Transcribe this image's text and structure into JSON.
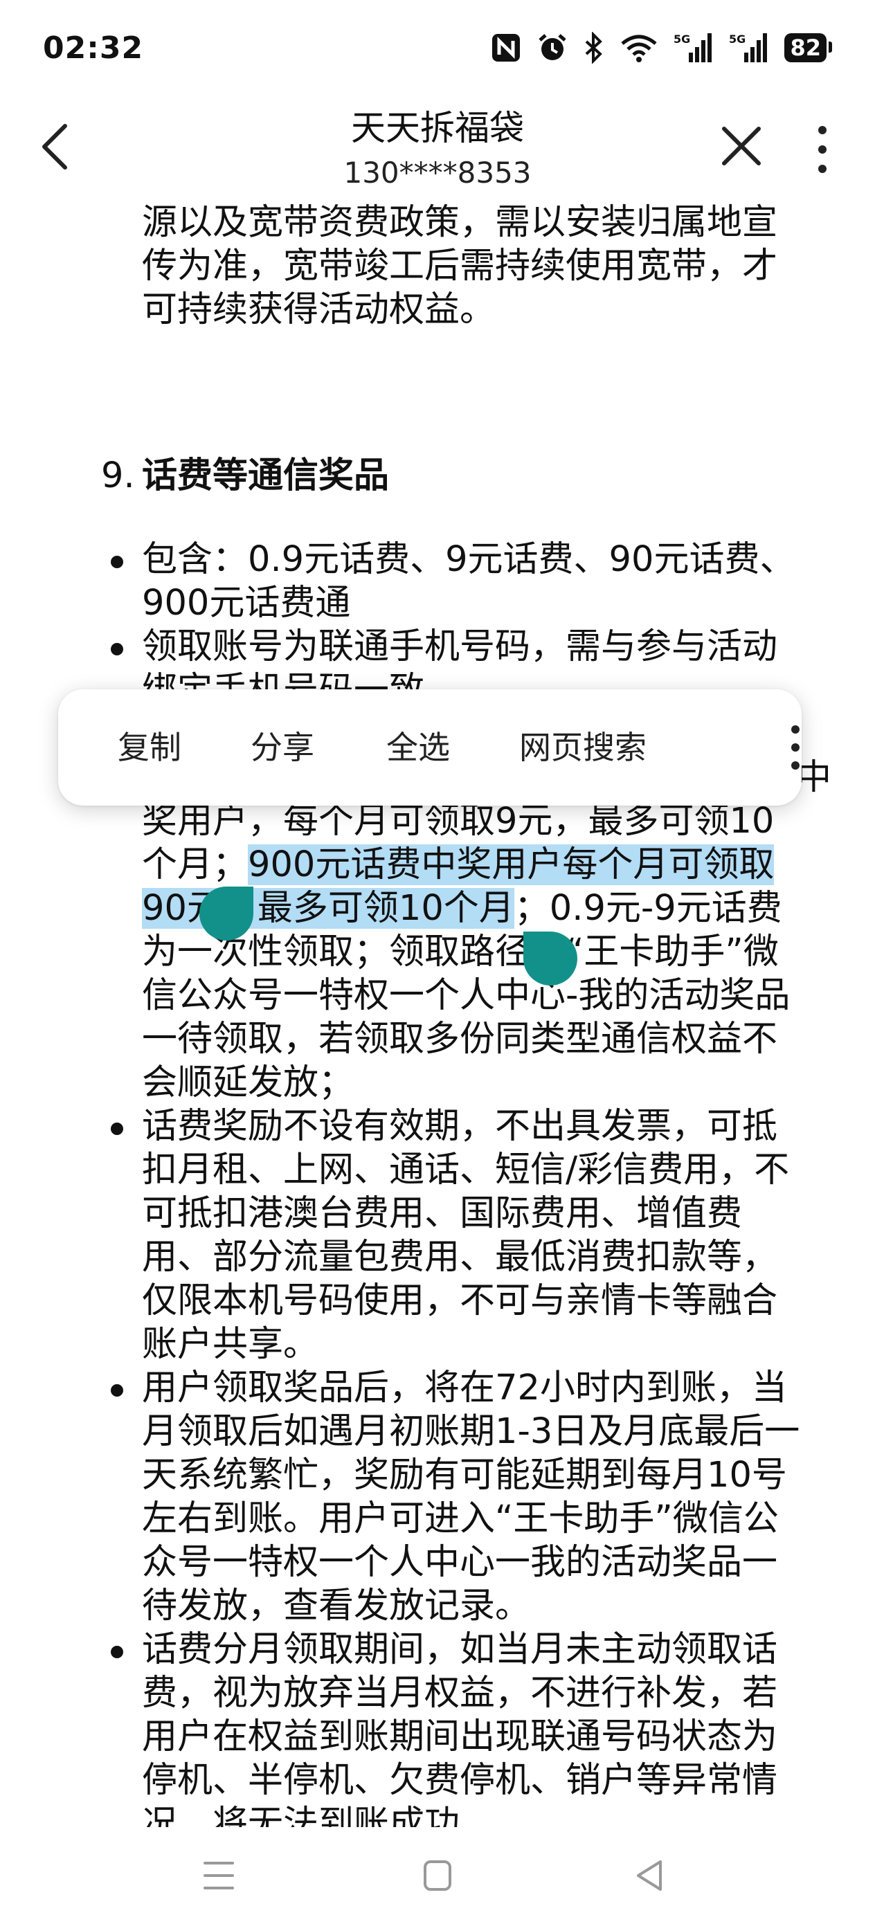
{
  "status_bar": {
    "time": "02:32",
    "battery": "82",
    "icons": [
      "nfc-icon",
      "alarm-icon",
      "bluetooth-icon",
      "wifi-icon",
      "signal-5g-icon",
      "signal-5g-icon",
      "battery-icon"
    ],
    "network_label_1": "5G",
    "network_label_2": "5G"
  },
  "header": {
    "title": "天天拆福袋",
    "subtitle": "130****8353"
  },
  "content": {
    "intro_lines": [
      "源以及宽带资费政策，需以安装归属地宣",
      "传为准，宽带竣工后需持续使用宽带，才",
      "可持续获得活动权益。"
    ],
    "section_number": "9.",
    "section_title": "话费等通信奖品",
    "bullet1_lines": [
      "包含：0.9元话费、9元话费、90元话费、",
      "900元话费通"
    ],
    "bullet2_lines": [
      "领取账号为联通手机号码，需与参与活动",
      "绑定手机号码一致"
    ],
    "bullet3_partial_end": "中",
    "bullet3_lines": [
      "奖用户，每个月可领取9元，最多可领10",
      "个月；",
      "900元话费中奖用户每个月可领取",
      "90元，最多可领10个月",
      "；0.9元-9元话费",
      "为一次性领取；领取路径：“王卡助手”微",
      "信公众号一特权一个人中心-我的活动奖品",
      "一待领取，若领取多份同类型通信权益不",
      "会顺延发放；"
    ],
    "bullet4_lines": [
      "话费奖励不设有效期，不出具发票，可抵",
      "扣月租、上网、通话、短信/彩信费用，不",
      "可抵扣港澳台费用、国际费用、增值费",
      "用、部分流量包费用、最低消费扣款等，",
      "仅限本机号码使用，不可与亲情卡等融合",
      "账户共享。"
    ],
    "bullet5_lines": [
      "用户领取奖品后，将在72小时内到账，当",
      "月领取后如遇月初账期1-3日及月底最后一",
      "天系统繁忙，奖励有可能延期到每月10号",
      "左右到账。用户可进入“王卡助手”微信公",
      "众号一特权一个人中心一我的活动奖品一",
      "待发放，查看发放记录。"
    ],
    "bullet6_lines": [
      "话费分月领取期间，如当月未主动领取话",
      "费，视为放弃当月权益，不进行补发，若",
      "用户在权益到账期间出现联通号码状态为",
      "停机、半停机、欠费停机、销户等异常情",
      "况，将无法到账成功"
    ]
  },
  "context_menu": {
    "copy": "复制",
    "share": "分享",
    "select_all": "全选",
    "web_search": "网页搜索"
  },
  "colors": {
    "selection": "#b3dcf5",
    "handle": "#12918a",
    "text": "#111111"
  }
}
